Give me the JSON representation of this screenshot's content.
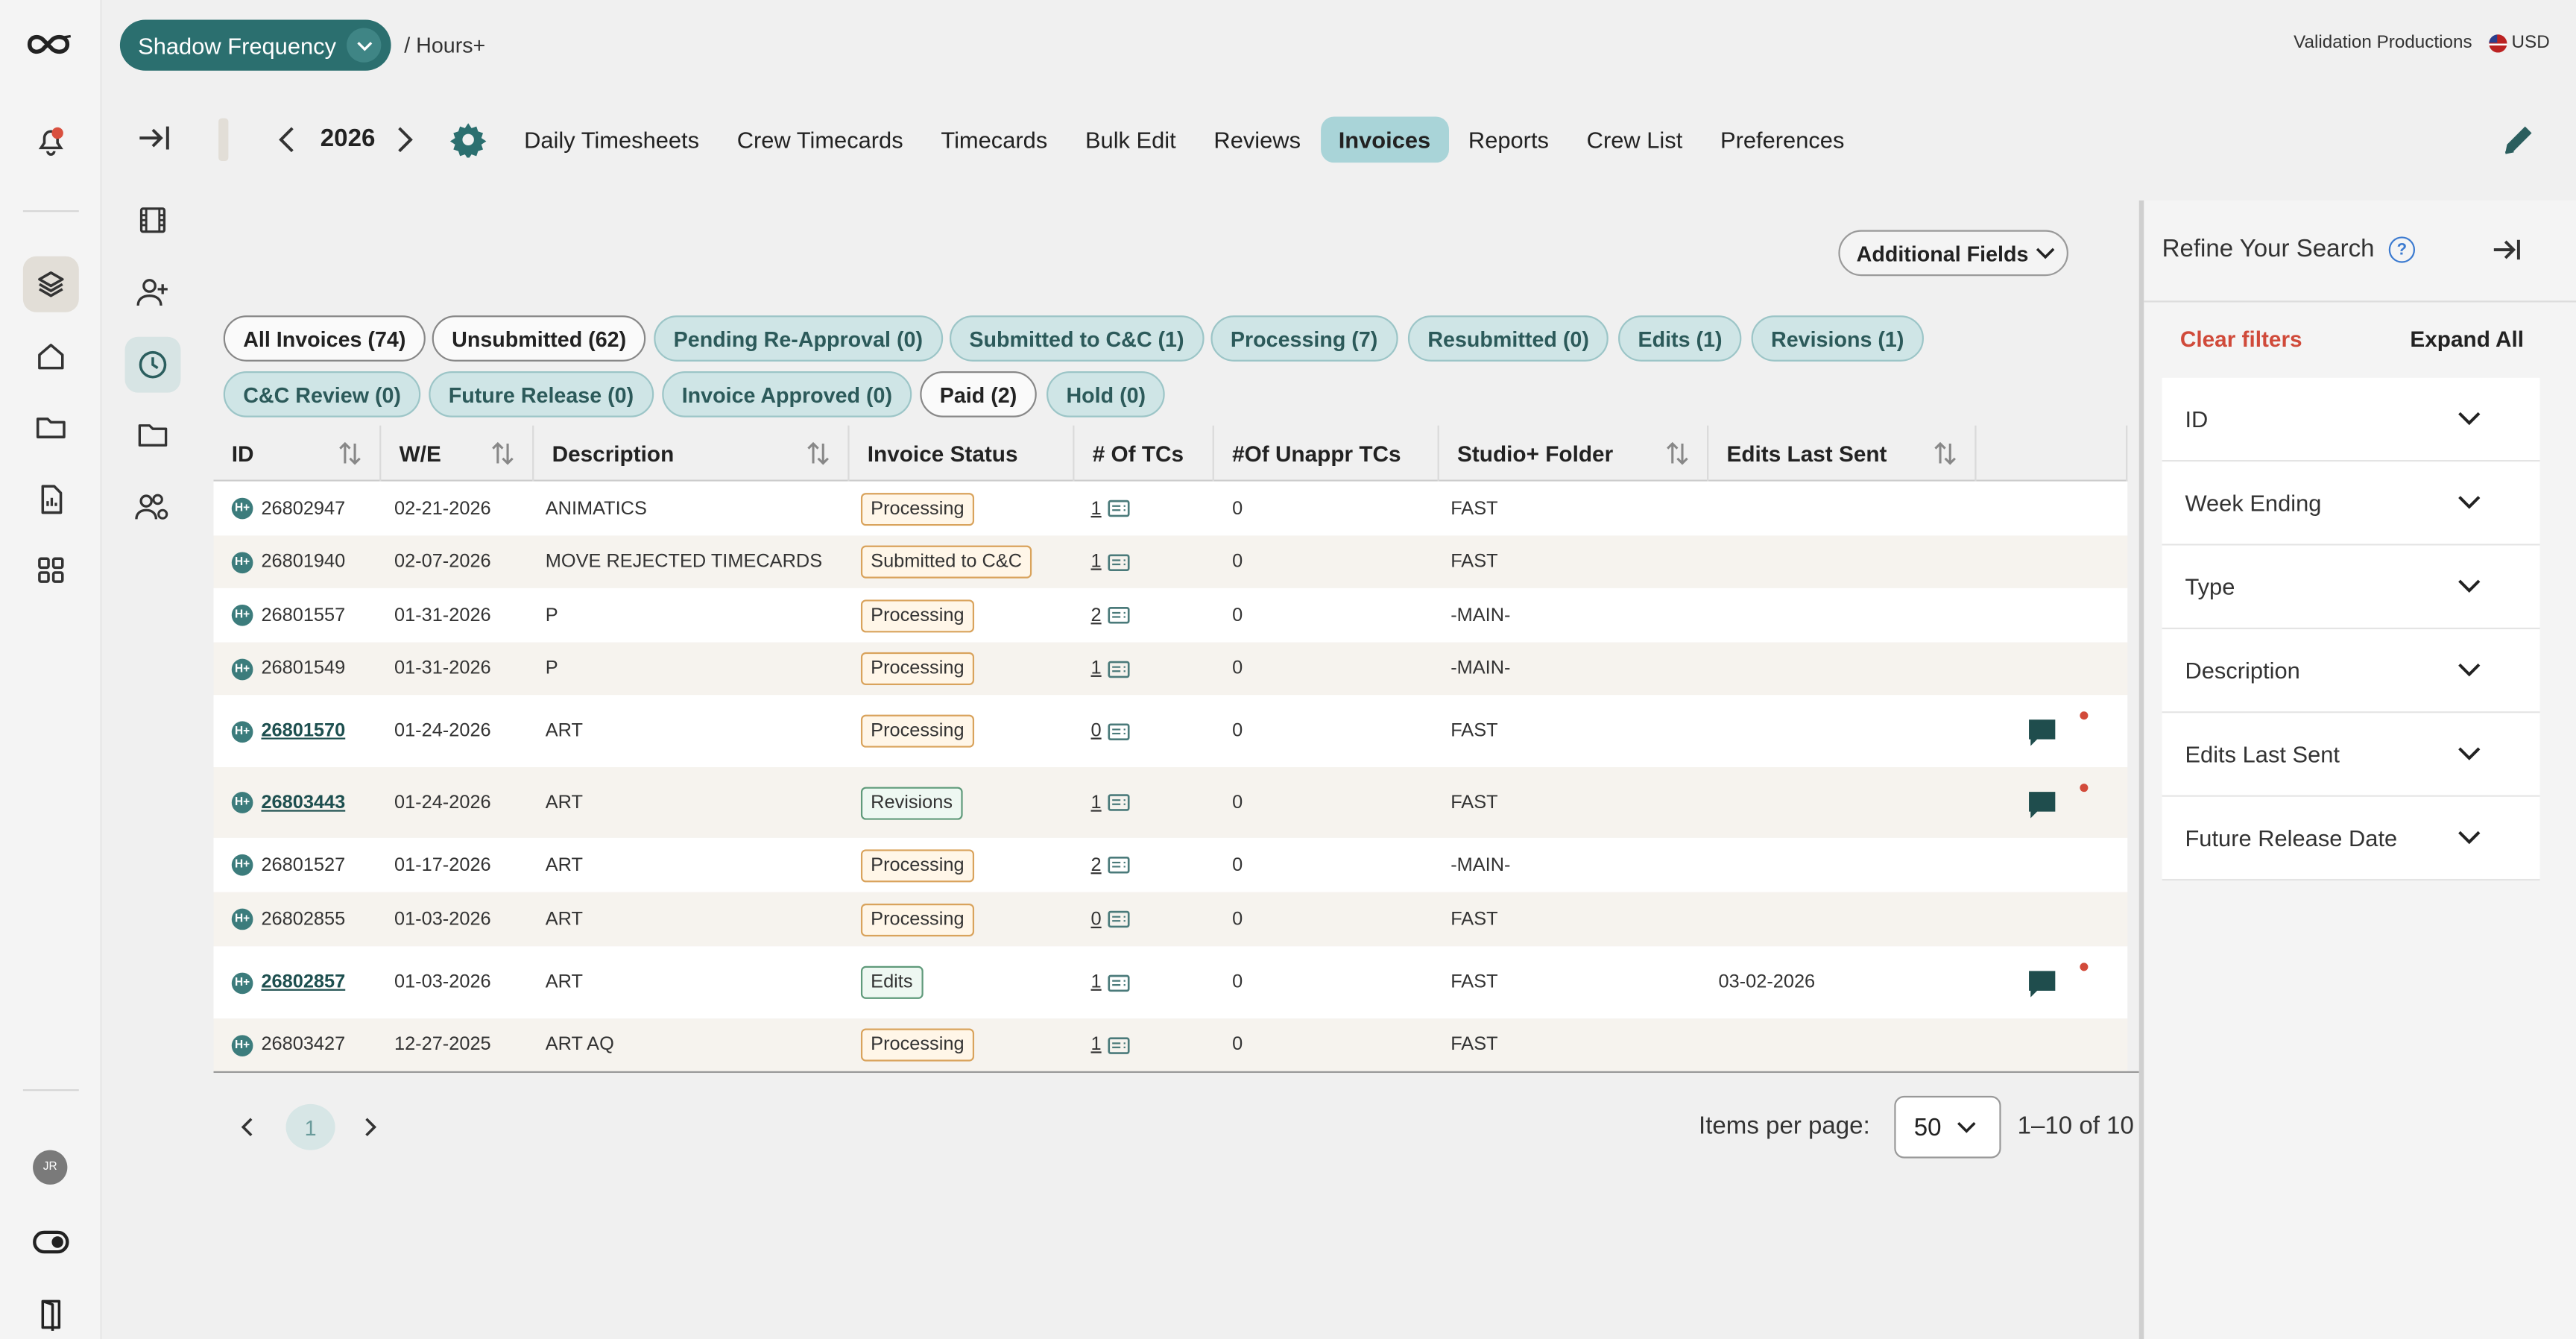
{
  "header": {
    "project": "Shadow Frequency",
    "breadcrumb": "/ Hours+",
    "company": "Validation Productions",
    "currency": "USD"
  },
  "user": {
    "initials": "JR"
  },
  "nav": {
    "year": "2026",
    "tabs": [
      {
        "label": "Daily Timesheets",
        "active": false
      },
      {
        "label": "Crew Timecards",
        "active": false
      },
      {
        "label": "Timecards",
        "active": false
      },
      {
        "label": "Bulk Edit",
        "active": false
      },
      {
        "label": "Reviews",
        "active": false
      },
      {
        "label": "Invoices",
        "active": true
      },
      {
        "label": "Reports",
        "active": false
      },
      {
        "label": "Crew List",
        "active": false
      },
      {
        "label": "Preferences",
        "active": false
      }
    ]
  },
  "toolbar": {
    "additional_fields": "Additional Fields"
  },
  "filters": [
    {
      "label": "All Invoices (74)",
      "style": "plain"
    },
    {
      "label": "Unsubmitted (62)",
      "style": "plain"
    },
    {
      "label": "Pending Re-Approval (0)",
      "style": "teal"
    },
    {
      "label": "Submitted to C&C (1)",
      "style": "teal"
    },
    {
      "label": "Processing (7)",
      "style": "teal"
    },
    {
      "label": "Resubmitted (0)",
      "style": "teal"
    },
    {
      "label": "Edits (1)",
      "style": "teal"
    },
    {
      "label": "Revisions (1)",
      "style": "teal"
    },
    {
      "label": "C&C Review (0)",
      "style": "teal"
    },
    {
      "label": "Future Release (0)",
      "style": "teal"
    },
    {
      "label": "Invoice Approved (0)",
      "style": "teal"
    },
    {
      "label": "Paid (2)",
      "style": "plain"
    },
    {
      "label": "Hold (0)",
      "style": "teal"
    }
  ],
  "table": {
    "headers": [
      "ID",
      "W/E",
      "Description",
      "Invoice Status",
      "# Of TCs",
      "#Of Unappr TCs",
      "Studio+ Folder",
      "Edits Last Sent"
    ],
    "badge": "H+",
    "rows": [
      {
        "id": "26802947",
        "we": "02-21-2026",
        "desc": "ANIMATICS",
        "status": "Processing",
        "tcs": "1",
        "unappr": "0",
        "folder": "FAST",
        "edits": "",
        "link": false,
        "comment": false
      },
      {
        "id": "26801940",
        "we": "02-07-2026",
        "desc": "MOVE REJECTED TIMECARDS",
        "status": "Submitted to C&C",
        "tcs": "1",
        "unappr": "0",
        "folder": "FAST",
        "edits": "",
        "link": false,
        "comment": false
      },
      {
        "id": "26801557",
        "we": "01-31-2026",
        "desc": "P",
        "status": "Processing",
        "tcs": "2",
        "unappr": "0",
        "folder": "-MAIN-",
        "edits": "",
        "link": false,
        "comment": false
      },
      {
        "id": "26801549",
        "we": "01-31-2026",
        "desc": "P",
        "status": "Processing",
        "tcs": "1",
        "unappr": "0",
        "folder": "-MAIN-",
        "edits": "",
        "link": false,
        "comment": false
      },
      {
        "id": "26801570",
        "we": "01-24-2026",
        "desc": "ART",
        "status": "Processing",
        "tcs": "0",
        "unappr": "0",
        "folder": "FAST",
        "edits": "",
        "link": true,
        "comment": true
      },
      {
        "id": "26803443",
        "we": "01-24-2026",
        "desc": "ART",
        "status": "Revisions",
        "tcs": "1",
        "unappr": "0",
        "folder": "FAST",
        "edits": "",
        "link": true,
        "comment": true
      },
      {
        "id": "26801527",
        "we": "01-17-2026",
        "desc": "ART",
        "status": "Processing",
        "tcs": "2",
        "unappr": "0",
        "folder": "-MAIN-",
        "edits": "",
        "link": false,
        "comment": false
      },
      {
        "id": "26802855",
        "we": "01-03-2026",
        "desc": "ART",
        "status": "Processing",
        "tcs": "0",
        "unappr": "0",
        "folder": "FAST",
        "edits": "",
        "link": false,
        "comment": false
      },
      {
        "id": "26802857",
        "we": "01-03-2026",
        "desc": "ART",
        "status": "Edits",
        "tcs": "1",
        "unappr": "0",
        "folder": "FAST",
        "edits": "03-02-2026",
        "link": true,
        "comment": true
      },
      {
        "id": "26803427",
        "we": "12-27-2025",
        "desc": "ART AQ",
        "status": "Processing",
        "tcs": "1",
        "unappr": "0",
        "folder": "FAST",
        "edits": "",
        "link": false,
        "comment": false
      }
    ]
  },
  "pagination": {
    "page": "1",
    "items_label": "Items per page:",
    "per_page": "50",
    "range": "1–10 of 10"
  },
  "refine": {
    "title": "Refine Your Search",
    "help": "?",
    "clear": "Clear filters",
    "expand": "Expand All",
    "facets": [
      "ID",
      "Week Ending",
      "Type",
      "Description",
      "Edits Last Sent",
      "Future Release Date"
    ]
  }
}
